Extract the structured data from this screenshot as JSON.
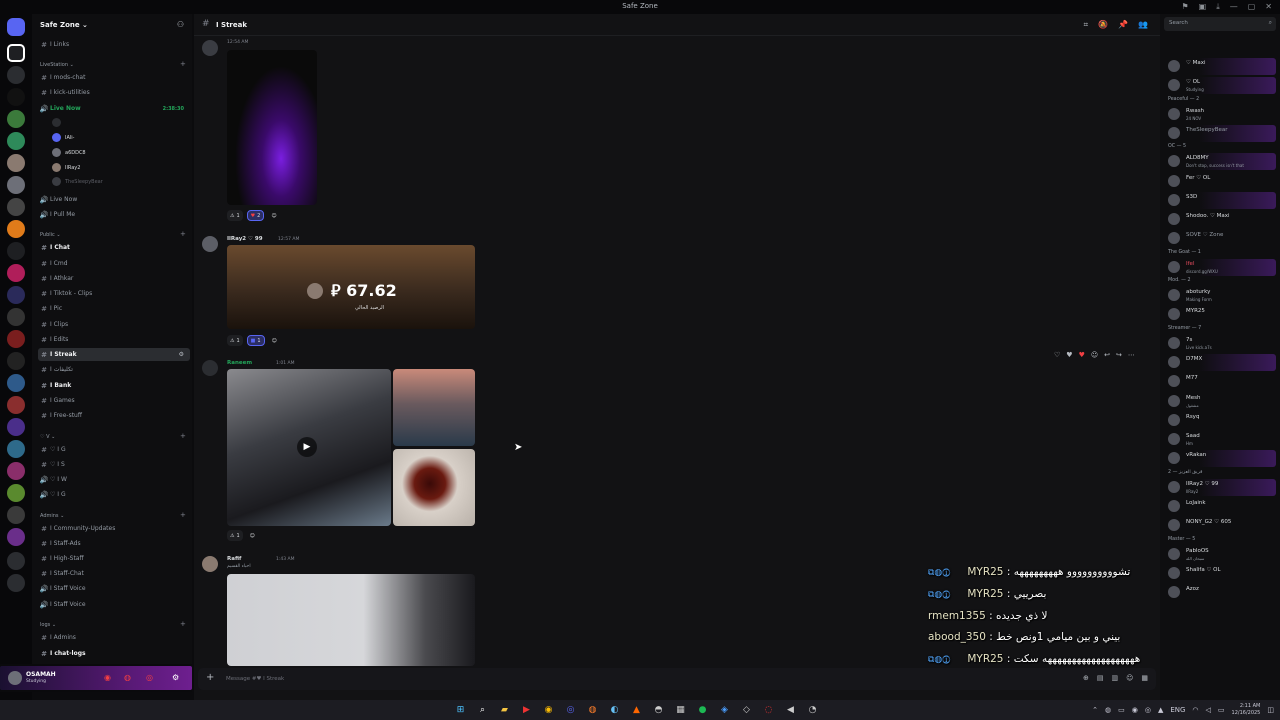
{
  "window": {
    "title": "Safe Zone"
  },
  "guild": {
    "name": "Safe Zone ⌄"
  },
  "sidebar": {
    "channels_top": [
      {
        "name": "I Links",
        "bold": false
      }
    ],
    "categories": [
      {
        "label": "LiveStation ⌄"
      },
      {
        "label": "Public ⌄"
      },
      {
        "label": "♡ V ⌄"
      },
      {
        "label": "Admins ⌄"
      },
      {
        "label": "logs ⌄"
      }
    ],
    "livestation": [
      {
        "name": "I mods-chat",
        "icon": "#"
      },
      {
        "name": "I kick-utilities",
        "icon": "#"
      },
      {
        "name": "Live Now",
        "icon": "●",
        "time": "2:38:30"
      }
    ],
    "voice_users": [
      {
        "name": ""
      },
      {
        "name": "IAli-"
      },
      {
        "name": "a6DDC8"
      },
      {
        "name": "IlRay2"
      },
      {
        "name": "TheSleepyBear"
      }
    ],
    "livestation_after": [
      {
        "name": "Live Now",
        "icon": "●"
      },
      {
        "name": "I Pull Me",
        "icon": "●"
      }
    ],
    "public": [
      {
        "name": "I Chat",
        "bold": true
      },
      {
        "name": "I Cmd",
        "bold": false
      },
      {
        "name": "I Athkar",
        "bold": false
      },
      {
        "name": "I Tiktok - Clips",
        "bold": false
      },
      {
        "name": "I Pic",
        "bold": false
      },
      {
        "name": "I Clips",
        "bold": false
      },
      {
        "name": "I Edits",
        "bold": false
      },
      {
        "name": "I Streak",
        "bold": true,
        "selected": true
      },
      {
        "name": "I تكليفات",
        "bold": false
      },
      {
        "name": "I Bank",
        "bold": true
      },
      {
        "name": "I Games",
        "bold": false
      },
      {
        "name": "I Free-stuff",
        "bold": false
      }
    ],
    "v": [
      {
        "name": "♡ I G"
      },
      {
        "name": "♡ I S"
      },
      {
        "name": "♡ I W"
      },
      {
        "name": "♡ I G"
      }
    ],
    "admins": [
      {
        "name": "I Community-Updates"
      },
      {
        "name": "I Staff-Ads"
      },
      {
        "name": "I High-Staff"
      },
      {
        "name": "I Staff-Chat"
      },
      {
        "name": "I Staff Voice"
      },
      {
        "name": "I Staff Voice"
      }
    ],
    "logs": [
      {
        "name": "I Admins",
        "bold": false
      },
      {
        "name": "I chat-logs",
        "bold": true
      }
    ]
  },
  "user": {
    "name": "OSAMAH",
    "status": "Studying"
  },
  "channel": {
    "hash": "#",
    "title": "I Streak"
  },
  "messages": [
    {
      "author": "",
      "time": "12:54 AM",
      "reactions": [
        {
          "emoji": "⚠",
          "count": "1"
        },
        {
          "emoji": "♥",
          "count": "2",
          "me": true
        }
      ]
    },
    {
      "author": "IlRay2 ♡ 99",
      "time": "12:57 AM",
      "image_text": "67.62",
      "image_sub": "الرصيد الحالي",
      "currency": "⃁",
      "reactions": [
        {
          "emoji": "⚠",
          "count": "1"
        },
        {
          "emoji": "■",
          "count": "1",
          "me": true
        }
      ]
    },
    {
      "author": "Raneem",
      "time": "1:01 AM",
      "reactions": [
        {
          "emoji": "⚠",
          "count": "1"
        }
      ]
    },
    {
      "author": "Rafif",
      "time": "1:43 AM",
      "reply": "احباء القسيم"
    }
  ],
  "composer": {
    "placeholder": "Message #♥ I Streak"
  },
  "overlay": [
    {
      "user": "MYR25",
      "text": "تشوووووووووو هههههههههه"
    },
    {
      "user": "MYR25",
      "text": "بصرييي"
    },
    {
      "user": "rmem1355",
      "text": "لا ذي جديده"
    },
    {
      "user": "abood_350",
      "text": "بيني و بين ميامي 1ونص خط"
    },
    {
      "user": "MYR25",
      "text": "هههههههههههههههههههه سكت"
    }
  ],
  "members": {
    "search_placeholder": "Search",
    "groups": [
      {
        "label": "Peaceful — 2"
      },
      {
        "label": "OC — 5"
      },
      {
        "label": "The Goat — 1"
      },
      {
        "label": "Mod. — 2"
      },
      {
        "label": "Streamer — 7"
      },
      {
        "label": "فريق العزيز — 2"
      },
      {
        "label": "Master — 5"
      }
    ],
    "list": [
      {
        "name": "♡ Maxi",
        "status": "",
        "color": "#dbdee1",
        "hl": true
      },
      {
        "name": "♡ OL",
        "status": "Studying",
        "color": "#dbdee1",
        "hl": true
      },
      {
        "name": "Rwash",
        "status": "24 NOV",
        "color": "#dbdee1",
        "hl": false
      },
      {
        "name": "TheSleepyBear",
        "status": "",
        "color": "#949ba4",
        "hl": true
      },
      {
        "name": "ALD8MY",
        "status": "Don't stop, success isn't that",
        "color": "#dbdee1",
        "hl": true
      },
      {
        "name": "Fer ♡ OL",
        "status": "",
        "color": "#dbdee1",
        "hl": false
      },
      {
        "name": "S3D",
        "status": "",
        "color": "#dbdee1",
        "hl": true
      },
      {
        "name": "Shodoo. ♡ Maxi",
        "status": "",
        "color": "#dbdee1",
        "hl": false
      },
      {
        "name": "SOVE ♡ Zone",
        "status": "",
        "color": "#949ba4",
        "hl": false
      },
      {
        "name": "Ifel",
        "status": "discord.gg/WXU",
        "color": "#e74c5e",
        "hl": true
      },
      {
        "name": "aboturky",
        "status": "Making Form",
        "color": "#dbdee1",
        "hl": false
      },
      {
        "name": "MYR25",
        "status": "",
        "color": "#dbdee1",
        "hl": false
      },
      {
        "name": "7s",
        "status": "Live kick.a7s",
        "color": "#dbdee1",
        "hl": false
      },
      {
        "name": "D7MX",
        "status": "",
        "color": "#dbdee1",
        "hl": true
      },
      {
        "name": "M77",
        "status": "",
        "color": "#dbdee1",
        "hl": false
      },
      {
        "name": "Mesh",
        "status": "مشغول",
        "color": "#dbdee1",
        "hl": false
      },
      {
        "name": "Rsyq",
        "status": "",
        "color": "#dbdee1",
        "hl": false
      },
      {
        "name": "Saad",
        "status": "Hm",
        "color": "#dbdee1",
        "hl": false
      },
      {
        "name": "vRakan",
        "status": "",
        "color": "#dbdee1",
        "hl": true
      },
      {
        "name": "IlRay2 ♡ 99",
        "status": "IlRay2",
        "color": "#dbdee1",
        "hl": true
      },
      {
        "name": "LoJaink",
        "status": "",
        "color": "#dbdee1",
        "hl": false
      },
      {
        "name": "NONY_G2 ♡ 605",
        "status": "",
        "color": "#dbdee1",
        "hl": false
      },
      {
        "name": "PabloOS",
        "status": "سبحان الله",
        "color": "#dbdee1",
        "hl": false
      },
      {
        "name": "Shalifa ♡ OL",
        "status": "",
        "color": "#dbdee1",
        "hl": false
      },
      {
        "name": "Azoz",
        "status": "",
        "color": "#dbdee1",
        "hl": false
      }
    ]
  },
  "taskbar": {
    "lang": "ENG",
    "time": "2:11 AM",
    "date": "12/16/2025"
  },
  "colors": {
    "accent": "#5865f2",
    "live": "#23a55a",
    "danger": "#f23f43",
    "purple": "#6e1f8f"
  }
}
